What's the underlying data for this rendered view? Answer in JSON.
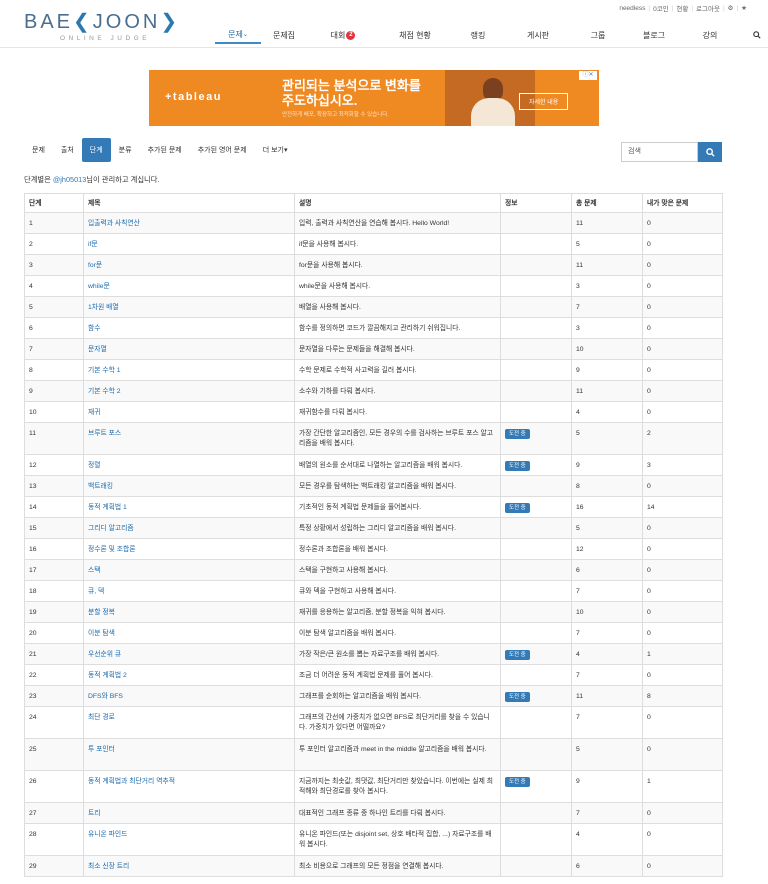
{
  "topbar": {
    "user": "needless",
    "codes": "0코인",
    "stats": "현황",
    "logout": "로그아웃"
  },
  "logo": {
    "main_left": "BAE",
    "main_k": "K",
    "main_right": "JOON",
    "sub": "ONLINE JUDGE"
  },
  "nav": {
    "items": [
      {
        "label": "문제",
        "width": 46
      },
      {
        "label": "문제집",
        "width": 46
      },
      {
        "label": "대회",
        "width": 72,
        "badge": "2"
      },
      {
        "label": "채점 현황",
        "width": 72
      },
      {
        "label": "랭킹",
        "width": 54
      },
      {
        "label": "게시판",
        "width": 66
      },
      {
        "label": "그룹",
        "width": 54
      },
      {
        "label": "블로그",
        "width": 58
      },
      {
        "label": "강의",
        "width": 54
      }
    ]
  },
  "ad": {
    "brand": "+tableau",
    "headline": "관리되는 분석으로 변화를 주도하십시오.",
    "small": "안전하게 배포, 확장하고 최적화할 수 있습니다.",
    "cta": "자세한 내용"
  },
  "tabs": {
    "items": [
      "문제",
      "출처",
      "단계",
      "분류",
      "추가된 문제",
      "추가된 영어 문제",
      "더 보기"
    ],
    "active": 2
  },
  "search": {
    "placeholder": "검색"
  },
  "manager": {
    "prefix": "단계별은 ",
    "user": "@jh05013",
    "suffix": "님이 관리하고 계십니다."
  },
  "table": {
    "headers": [
      "단계",
      "제목",
      "설명",
      "정보",
      "총 문제",
      "내가 맞은 문제"
    ],
    "challenge_label": "도전 중",
    "rows": [
      {
        "n": "1",
        "title": "입출력과 사칙연산",
        "desc": "입력, 출력과 사칙연산을 연습해 봅시다. Hello World!",
        "info": "",
        "total": "11",
        "solved": "0",
        "h": 21
      },
      {
        "n": "2",
        "title": "if문",
        "desc": "if문을 사용해 봅시다.",
        "info": "",
        "total": "5",
        "solved": "0",
        "h": 21
      },
      {
        "n": "3",
        "title": "for문",
        "desc": "for문을 사용해 봅시다.",
        "info": "",
        "total": "11",
        "solved": "0",
        "h": 21
      },
      {
        "n": "4",
        "title": "while문",
        "desc": "while문을 사용해 봅시다.",
        "info": "",
        "total": "3",
        "solved": "0",
        "h": 21
      },
      {
        "n": "5",
        "title": "1차원 배열",
        "desc": "배열을 사용해 봅시다.",
        "info": "",
        "total": "7",
        "solved": "0",
        "h": 21
      },
      {
        "n": "6",
        "title": "함수",
        "desc": "함수를 정의하면 코드가 깔끔해지고 관리하기 쉬워집니다.",
        "info": "",
        "total": "3",
        "solved": "0",
        "h": 21
      },
      {
        "n": "7",
        "title": "문자열",
        "desc": "문자열을 다루는 문제들을 해결해 봅시다.",
        "info": "",
        "total": "10",
        "solved": "0",
        "h": 21
      },
      {
        "n": "8",
        "title": "기본 수학 1",
        "desc": "수학 문제로 수학적 사고력을 길러 봅시다.",
        "info": "",
        "total": "9",
        "solved": "0",
        "h": 21
      },
      {
        "n": "9",
        "title": "기본 수학 2",
        "desc": "소수와 기하를 다뤄 봅시다.",
        "info": "",
        "total": "11",
        "solved": "0",
        "h": 21
      },
      {
        "n": "10",
        "title": "재귀",
        "desc": "재귀함수를 다뤄 봅시다.",
        "info": "",
        "total": "4",
        "solved": "0",
        "h": 21
      },
      {
        "n": "11",
        "title": "브루트 포스",
        "desc": "가장 간단한 알고리즘인, 모든 경우의 수를 검사하는 브루트 포스 알고리즘을 배워 봅시다.",
        "info": "challenge",
        "total": "5",
        "solved": "2",
        "h": 32
      },
      {
        "n": "12",
        "title": "정렬",
        "desc": "배열의 원소를 순서대로 나열하는 알고리즘을 배워 봅시다.",
        "info": "challenge",
        "total": "9",
        "solved": "3",
        "h": 21
      },
      {
        "n": "13",
        "title": "백트래킹",
        "desc": "모든 경우를 탐색하는 백트래킹 알고리즘을 배워 봅시다.",
        "info": "",
        "total": "8",
        "solved": "0",
        "h": 21
      },
      {
        "n": "14",
        "title": "동적 계획법 1",
        "desc": "기초적인 동적 계획법 문제들을 풀어봅시다.",
        "info": "challenge",
        "total": "16",
        "solved": "14",
        "h": 21
      },
      {
        "n": "15",
        "title": "그리디 알고리즘",
        "desc": "특정 상황에서 성립하는 그리디 알고리즘을 배워 봅시다.",
        "info": "",
        "total": "5",
        "solved": "0",
        "h": 21
      },
      {
        "n": "16",
        "title": "정수론 및 조합론",
        "desc": "정수론과 조합론을 배워 봅시다.",
        "info": "",
        "total": "12",
        "solved": "0",
        "h": 21
      },
      {
        "n": "17",
        "title": "스택",
        "desc": "스택을 구현하고 사용해 봅시다.",
        "info": "",
        "total": "6",
        "solved": "0",
        "h": 21
      },
      {
        "n": "18",
        "title": "큐, 덱",
        "desc": "큐와 덱을 구현하고 사용해 봅시다.",
        "info": "",
        "total": "7",
        "solved": "0",
        "h": 21
      },
      {
        "n": "19",
        "title": "분할 정복",
        "desc": "재귀를 응용하는 알고리즘, 분할 정복을 익혀 봅시다.",
        "info": "",
        "total": "10",
        "solved": "0",
        "h": 21
      },
      {
        "n": "20",
        "title": "이분 탐색",
        "desc": "이분 탐색 알고리즘을 배워 봅시다.",
        "info": "",
        "total": "7",
        "solved": "0",
        "h": 21
      },
      {
        "n": "21",
        "title": "우선순위 큐",
        "desc": "가장 작은/큰 원소를 뽑는 자료구조를 배워 봅시다.",
        "info": "challenge",
        "total": "4",
        "solved": "1",
        "h": 21
      },
      {
        "n": "22",
        "title": "동적 계획법 2",
        "desc": "조금 더 어려운 동적 계획법 문제를 풀어 봅시다.",
        "info": "",
        "total": "7",
        "solved": "0",
        "h": 21
      },
      {
        "n": "23",
        "title": "DFS와 BFS",
        "desc": "그래프를 순회하는 알고리즘을 배워 봅시다.",
        "info": "challenge",
        "total": "11",
        "solved": "8",
        "h": 21
      },
      {
        "n": "24",
        "title": "최단 경로",
        "desc": "그래프의 간선에 가중치가 없으면 BFS로 최단거리를 찾을 수 있습니다. 가중치가 있다면 어떨까요?",
        "info": "",
        "total": "7",
        "solved": "0",
        "h": 32
      },
      {
        "n": "25",
        "title": "투 포인터",
        "desc": "투 포인터 알고리즘과 meet in the middle 알고리즘을 배워 봅시다.",
        "info": "",
        "total": "5",
        "solved": "0",
        "h": 32
      },
      {
        "n": "26",
        "title": "동적 계획법과 최단거리 역추적",
        "desc": "지금까지는 최솟값, 최댓값, 최단거리만 찾았습니다. 이번에는 실제 최적해와 최단경로를 찾아 봅시다.",
        "info": "challenge",
        "total": "9",
        "solved": "1",
        "h": 32
      },
      {
        "n": "27",
        "title": "트리",
        "desc": "대표적인 그래프 종류 중 하나인 트리를 다뤄 봅시다.",
        "info": "",
        "total": "7",
        "solved": "0",
        "h": 21
      },
      {
        "n": "28",
        "title": "유니온 파인드",
        "desc": "유니온 파인드(또는 disjoint set, 상호 배타적 집합, ...) 자료구조를 배워 봅시다.",
        "info": "",
        "total": "4",
        "solved": "0",
        "h": 32
      },
      {
        "n": "29",
        "title": "최소 신장 트리",
        "desc": "최소 비용으로 그래프의 모든 정점을 연결해 봅시다.",
        "info": "",
        "total": "6",
        "solved": "0",
        "h": 21
      }
    ]
  },
  "colors": {
    "accent": "#337ab7",
    "ad_bg": "#ef8a23",
    "badge": "#e5333d"
  }
}
